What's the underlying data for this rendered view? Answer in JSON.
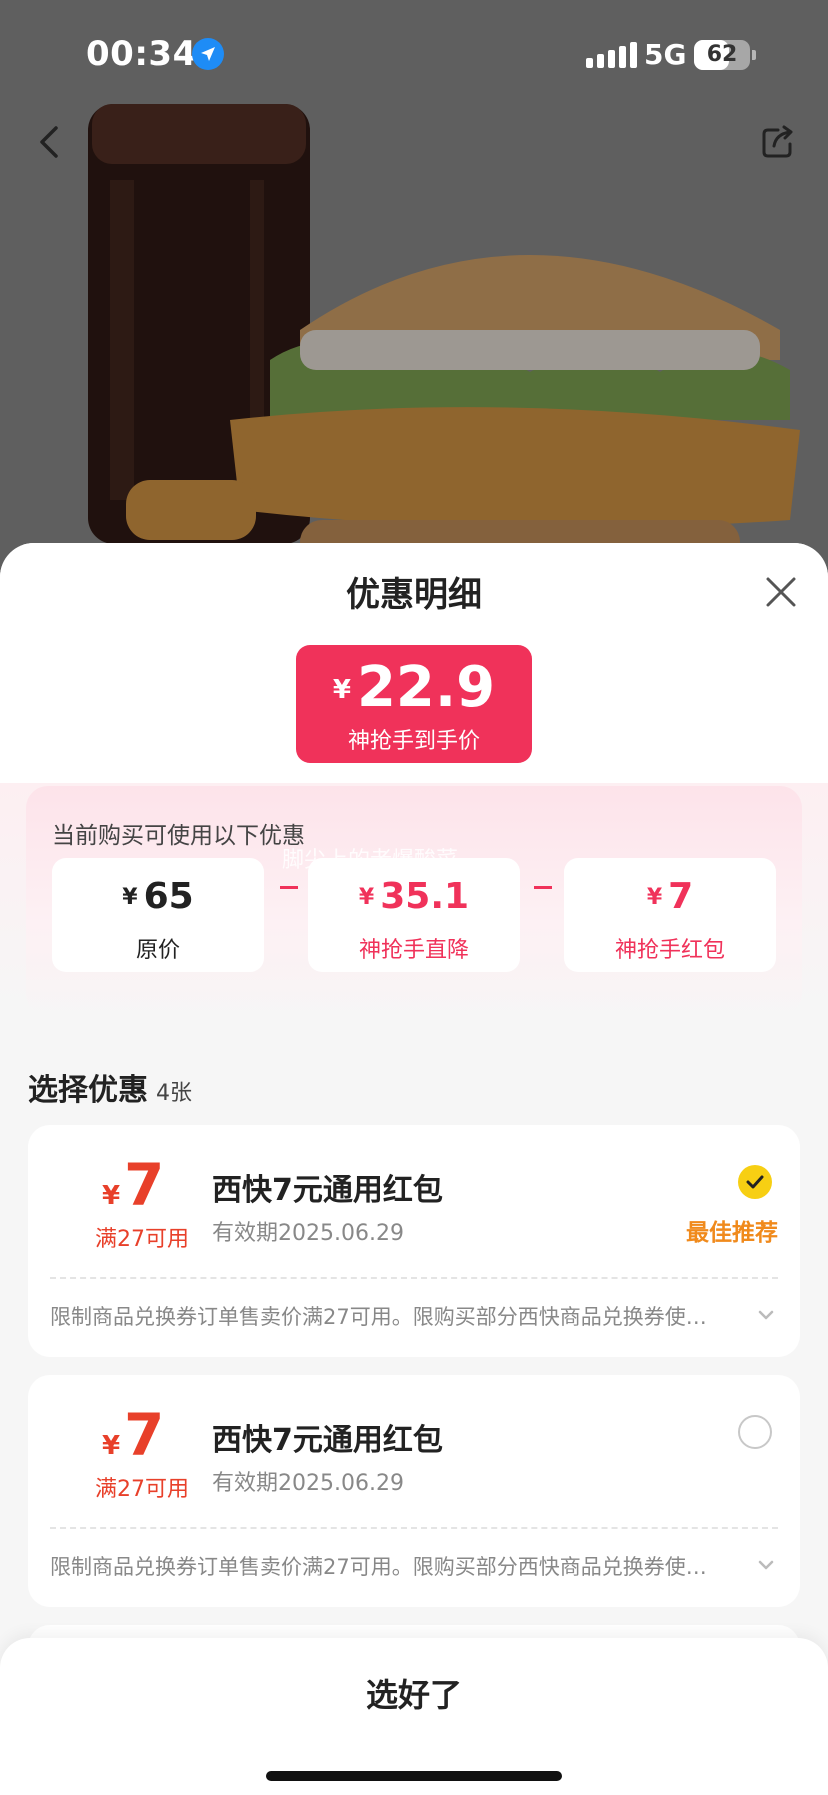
{
  "status_bar": {
    "time": "00:34",
    "network": "5G",
    "battery": "62",
    "battery_level": 0.62
  },
  "sheet": {
    "title": "优惠明细",
    "final_price": {
      "currency": "¥",
      "value": "22.9",
      "caption": "神抢手到手价"
    },
    "breakdown": {
      "label": "当前购买可使用以下优惠",
      "watermark": "脚尖上的老爆酸菜",
      "items": [
        {
          "currency": "¥",
          "value": "65",
          "caption": "原价"
        },
        {
          "currency": "¥",
          "value": "35.1",
          "caption": "神抢手直降"
        },
        {
          "currency": "¥",
          "value": "7",
          "caption": "神抢手红包"
        }
      ]
    },
    "coupons_section": {
      "title": "选择优惠",
      "count": "4张"
    },
    "coupons": [
      {
        "currency": "¥",
        "amount": "7",
        "condition": "满27可用",
        "name": "西快7元通用红包",
        "expiry": "有效期2025.06.29",
        "selected": true,
        "badge": "最佳推荐",
        "description": "限制商品兑换券订单售卖价满27可用。限购买部分西快商品兑换券使…"
      },
      {
        "currency": "¥",
        "amount": "7",
        "condition": "满27可用",
        "name": "西快7元通用红包",
        "expiry": "有效期2025.06.29",
        "selected": false,
        "badge": "",
        "description": "限制商品兑换券订单售卖价满27可用。限购买部分西快商品兑换券使…"
      }
    ],
    "confirm_label": "选好了"
  },
  "colors": {
    "accent": "#f0325a",
    "coupon_red": "#e8402a",
    "best_orange": "#f08a1c",
    "check_yellow": "#f7cf13"
  },
  "icons": [
    "back-arrow-icon",
    "share-icon",
    "close-icon",
    "location-arrow-icon",
    "checkmark-icon",
    "chevron-down-icon"
  ]
}
